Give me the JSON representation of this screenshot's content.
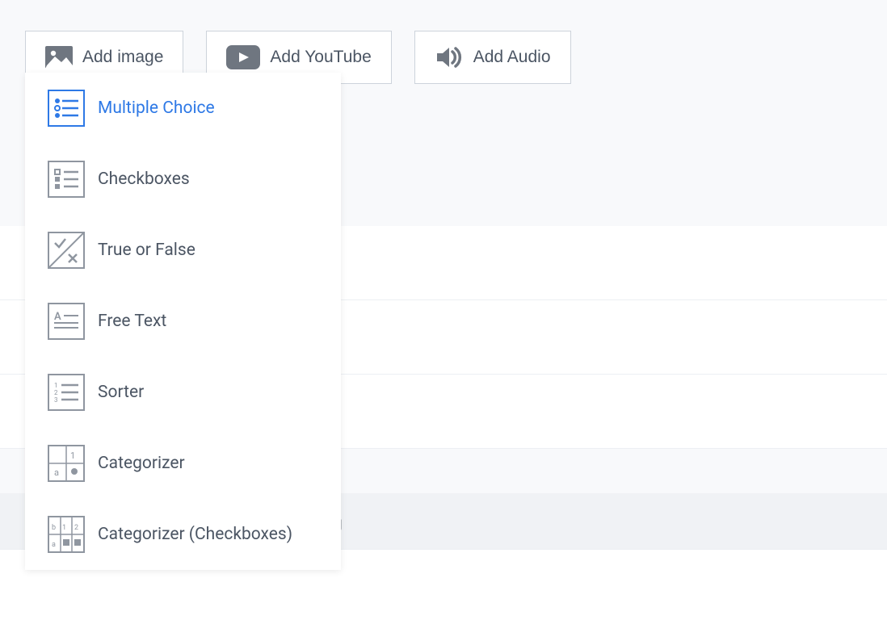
{
  "toolbar": {
    "add_image": "Add image",
    "add_youtube": "Add YouTube",
    "add_audio": "Add Audio"
  },
  "dropdown": {
    "items": [
      {
        "label": "Multiple Choice"
      },
      {
        "label": "Checkboxes"
      },
      {
        "label": "True or False"
      },
      {
        "label": "Free Text"
      },
      {
        "label": "Sorter"
      },
      {
        "label": "Categorizer"
      },
      {
        "label": "Categorizer (Checkboxes)"
      }
    ]
  },
  "peek": "g"
}
